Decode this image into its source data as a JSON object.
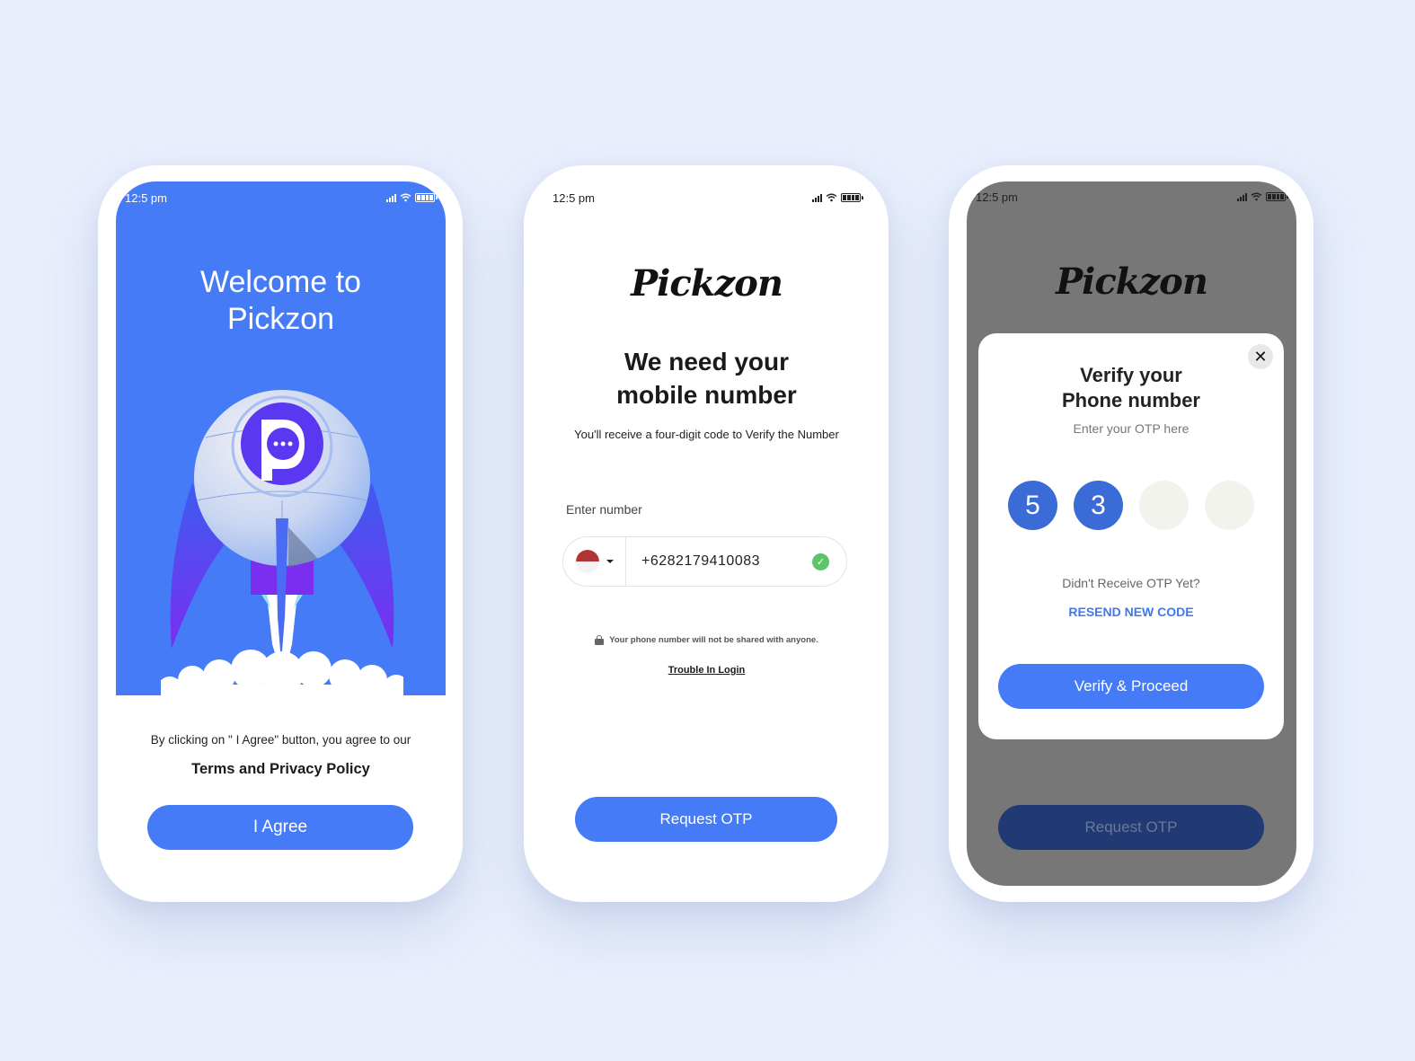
{
  "app_name": "Pickzon",
  "colors": {
    "background": "#e8eefc",
    "primary": "#467bf7",
    "otp_filled": "#3a6bd6",
    "otp_empty": "#f2f3ec",
    "success": "#5cc46a",
    "flag_red": "#b03434",
    "overlay": "#777777",
    "link": "#3f78f1"
  },
  "screens": [
    {
      "status": {
        "time": "12:5 pm",
        "icons": [
          "signal-icon",
          "wifi-icon",
          "battery-icon"
        ]
      },
      "welcome_title": "Welcome to\nPickzon",
      "illustration": "rocket-launch-with-pickzon-logo",
      "agree_text": "By clicking on \" I Agree\" button, you agree to our",
      "terms_link": "Terms and Privacy Policy",
      "agree_button": "I Agree"
    },
    {
      "status": {
        "time": "12:5 pm",
        "icons": [
          "signal-icon",
          "wifi-icon",
          "battery-icon"
        ]
      },
      "logo": "Pickzon",
      "headline": "We need your\nmobile number",
      "subtext": "You'll receive a four-digit code to Verify the Number",
      "input_label": "Enter number",
      "country_flag": "indonesia-flag",
      "phone_value": "+6282179410083",
      "valid_icon": "check-circle-icon",
      "privacy_note": "Your phone number will not be shared with anyone.",
      "trouble_link": "Trouble In Login",
      "request_button": "Request OTP"
    },
    {
      "status": {
        "time": "12:5 pm",
        "icons": [
          "signal-icon",
          "wifi-icon",
          "battery-icon"
        ]
      },
      "logo": "Pickzon",
      "modal": {
        "title": "Verify your\nPhone number",
        "subtitle": "Enter your OTP here",
        "otp_digits": [
          "5",
          "3",
          "",
          ""
        ],
        "didnt_receive": "Didn't Receive OTP Yet?",
        "resend": "RESEND NEW CODE",
        "verify_button": "Verify & Proceed",
        "close_icon": "close-icon"
      },
      "background_button": "Request OTP"
    }
  ]
}
